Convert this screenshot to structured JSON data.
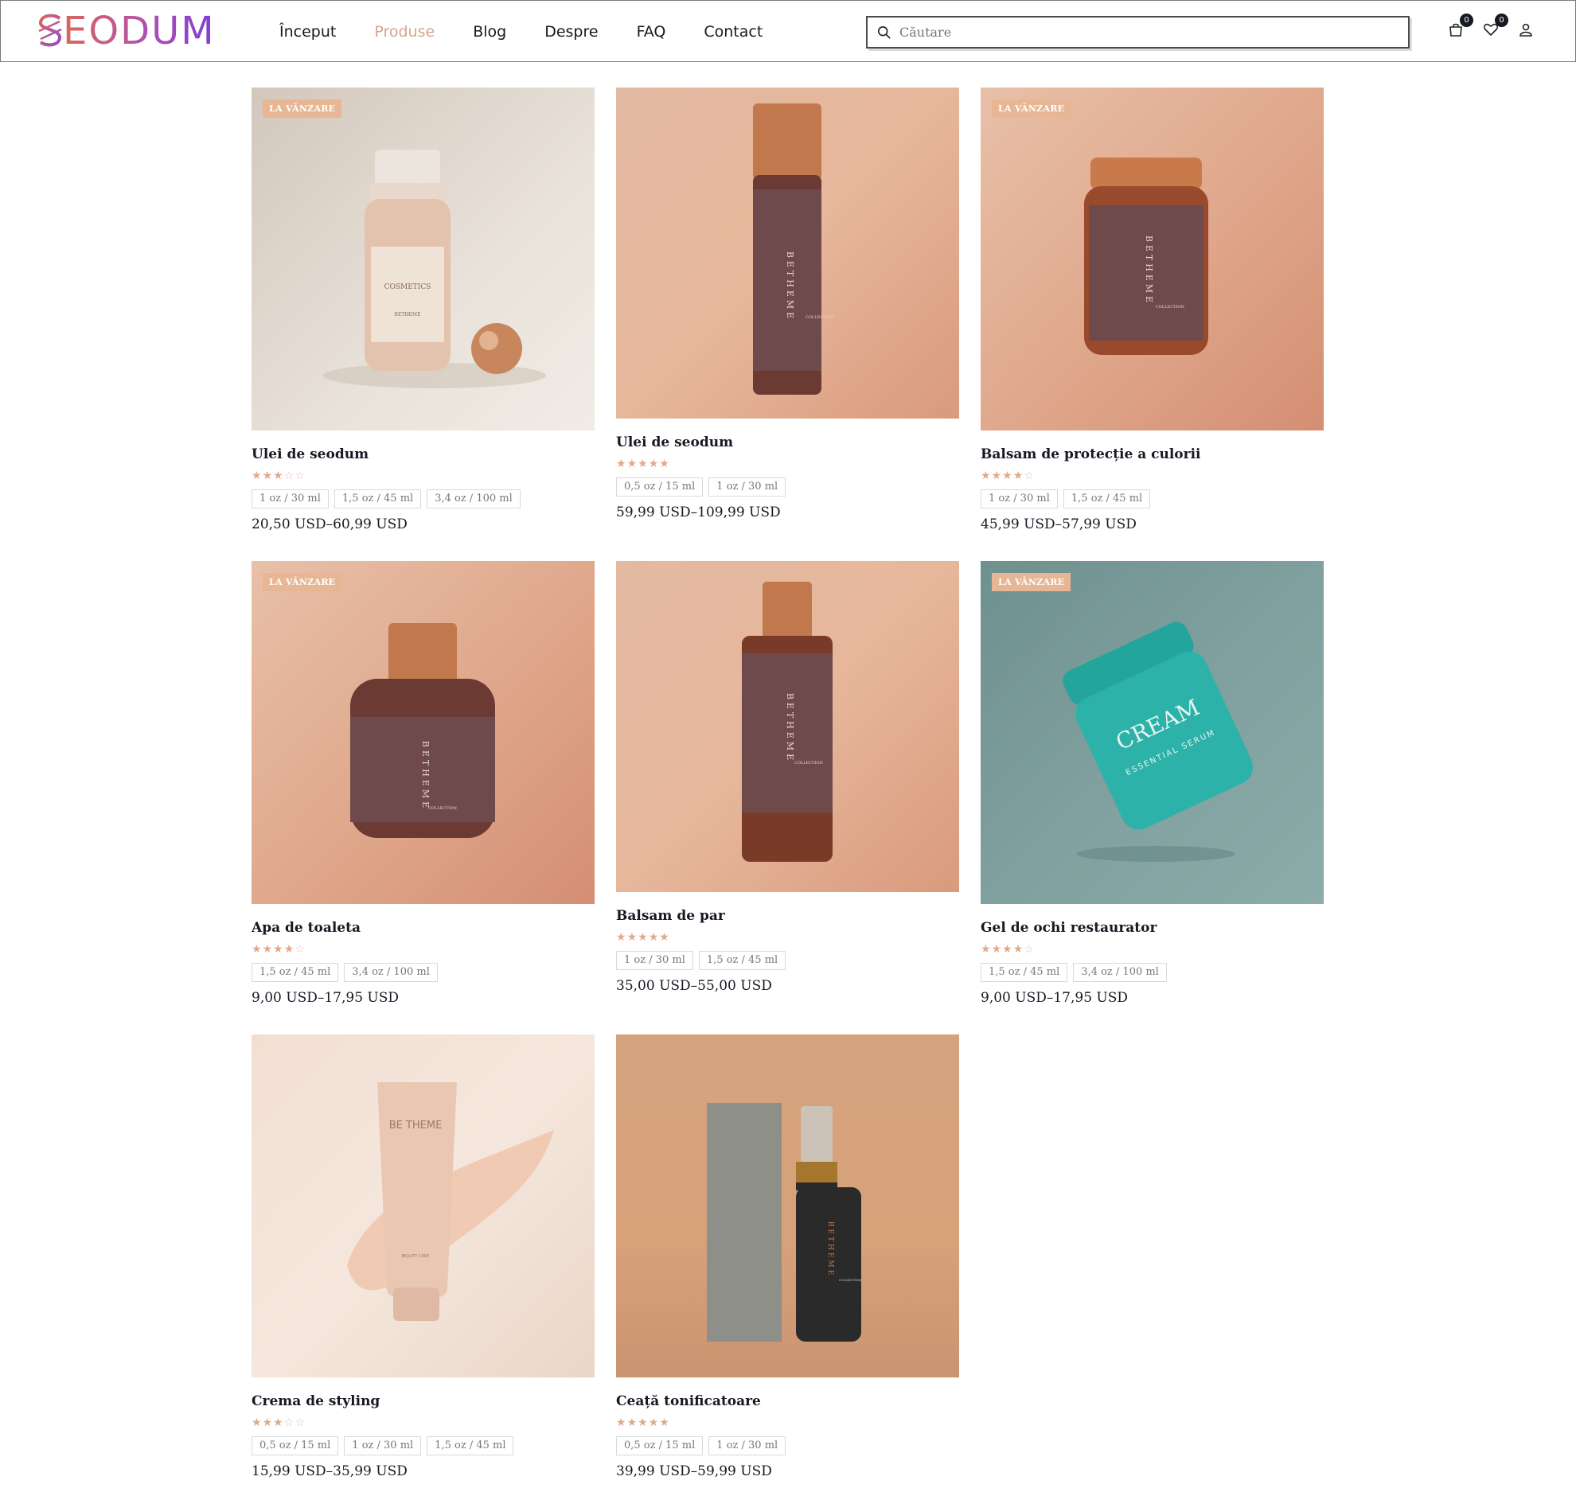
{
  "brand": {
    "logo_text": "EODUM",
    "logo_letter": "S"
  },
  "nav": {
    "items": [
      {
        "label": "Început",
        "active": false
      },
      {
        "label": "Produse",
        "active": true
      },
      {
        "label": "Blog",
        "active": false
      },
      {
        "label": "Despre",
        "active": false
      },
      {
        "label": "FAQ",
        "active": false
      },
      {
        "label": "Contact",
        "active": false
      }
    ]
  },
  "search": {
    "placeholder": "Căutare",
    "value": ""
  },
  "header_icons": {
    "cart_icon": "cart-icon",
    "cart_count": "0",
    "wishlist_icon": "heart-icon",
    "wishlist_count": "0",
    "account_icon": "user-icon"
  },
  "colors": {
    "accent": "#d8a488",
    "badge_bg": "#e7b795",
    "text": "#161922"
  },
  "sale_label": "LA VÂNZARE",
  "products": [
    {
      "name": "Ulei de seodum",
      "rating": 3,
      "sale": true,
      "variants": [
        "1 oz / 30 ml",
        "1,5 oz / 45 ml",
        "3,4 oz / 100 ml"
      ],
      "price": "20,50 USD–60,99 USD",
      "image_text": [
        "COSMETICS",
        "BETHEME"
      ]
    },
    {
      "name": "Ulei de seodum",
      "rating": 5,
      "sale": false,
      "variants": [
        "0,5 oz / 15 ml",
        "1 oz / 30 ml"
      ],
      "price": "59,99 USD–109,99 USD",
      "image_text": [
        "BETHEME",
        "COLLECTION"
      ]
    },
    {
      "name": "Balsam de protecție a culorii",
      "rating": 4,
      "sale": true,
      "variants": [
        "1 oz / 30 ml",
        "1,5 oz / 45 ml"
      ],
      "price": "45,99 USD–57,99 USD",
      "image_text": [
        "BETHEME",
        "COLLECTION"
      ]
    },
    {
      "name": "Apa de toaleta",
      "rating": 4,
      "sale": true,
      "variants": [
        "1,5 oz / 45 ml",
        "3,4 oz / 100 ml"
      ],
      "price": "9,00 USD–17,95 USD",
      "image_text": [
        "BETHEME",
        "COLLECTION"
      ]
    },
    {
      "name": "Balsam de par",
      "rating": 5,
      "sale": false,
      "variants": [
        "1 oz / 30 ml",
        "1,5 oz / 45 ml"
      ],
      "price": "35,00 USD–55,00 USD",
      "image_text": [
        "BETHEME",
        "COLLECTION"
      ]
    },
    {
      "name": "Gel de ochi restaurator",
      "rating": 4,
      "sale": true,
      "variants": [
        "1,5 oz / 45 ml",
        "3,4 oz / 100 ml"
      ],
      "price": "9,00 USD–17,95 USD",
      "image_text": [
        "CREAM",
        "ESSENTIAL SERUM"
      ]
    },
    {
      "name": "Crema de styling",
      "rating": 3,
      "sale": false,
      "variants": [
        "0,5 oz / 15 ml",
        "1 oz / 30 ml",
        "1,5 oz / 45 ml"
      ],
      "price": "15,99 USD–35,99 USD",
      "image_text": [
        "BE THEME",
        "BEAUTY CARE"
      ]
    },
    {
      "name": "Ceață tonificatoare",
      "rating": 5,
      "sale": false,
      "variants": [
        "0,5 oz / 15 ml",
        "1 oz / 30 ml"
      ],
      "price": "39,99 USD–59,99 USD",
      "image_text": [
        "BETHEME",
        "COLLECTION"
      ]
    }
  ]
}
